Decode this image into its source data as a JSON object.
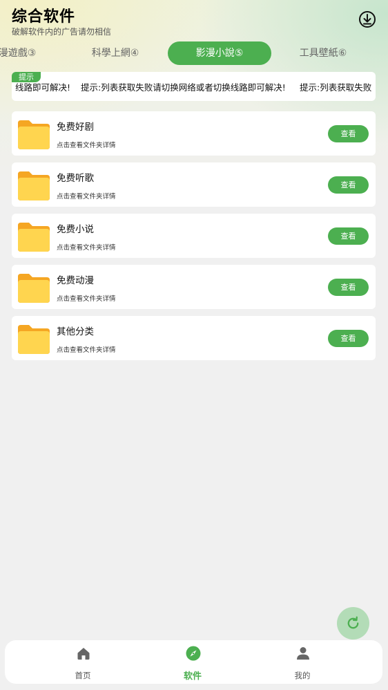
{
  "header": {
    "title": "综合软件",
    "subtitle": "破解软件内的广告请勿相信",
    "download_icon": "download-icon"
  },
  "tabs": [
    {
      "label": "漫遊戲③",
      "active": false
    },
    {
      "label": "科學上網④",
      "active": false
    },
    {
      "label": "影漫小說⑤",
      "active": true
    },
    {
      "label": "工具壁紙⑥",
      "active": false
    }
  ],
  "notice": {
    "badge": "提示",
    "segments": [
      "线路即可解决!",
      "提示:列表获取失败请切换网络或者切换线路即可解决!",
      "提示:列表获取失败"
    ]
  },
  "folders": [
    {
      "name": "免费好剧",
      "desc": "点击查看文件夹详情",
      "button": "查看"
    },
    {
      "name": "免费听歌",
      "desc": "点击查看文件夹详情",
      "button": "查看"
    },
    {
      "name": "免费小说",
      "desc": "点击查看文件夹详情",
      "button": "查看"
    },
    {
      "name": "免费动漫",
      "desc": "点击查看文件夹详情",
      "button": "查看"
    },
    {
      "name": "其他分类",
      "desc": "点击查看文件夹详情",
      "button": "查看"
    }
  ],
  "fab": {
    "icon": "refresh-icon"
  },
  "bottom_nav": [
    {
      "label": "首页",
      "icon": "home-icon",
      "active": false
    },
    {
      "label": "软件",
      "icon": "compass-icon",
      "active": true
    },
    {
      "label": "我的",
      "icon": "user-icon",
      "active": false
    }
  ],
  "colors": {
    "accent": "#4caf50",
    "folder_back": "#f5a623",
    "folder_front": "#ffd54f",
    "fab_bg": "#b3dcb7",
    "background": "#f0f0f0"
  }
}
